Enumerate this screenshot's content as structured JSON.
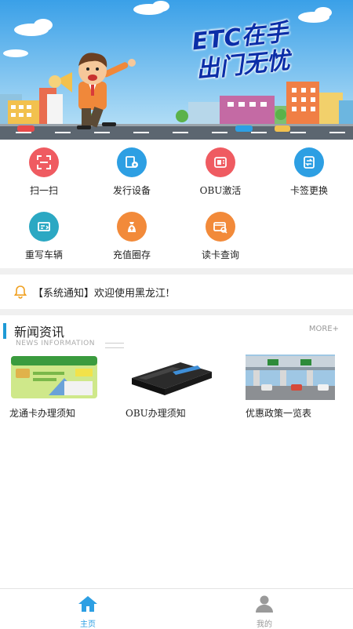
{
  "banner": {
    "title_line1": "ETC在手",
    "title_line2": "出门无忧"
  },
  "grid": {
    "items": [
      {
        "label": "扫一扫",
        "color": "#ef5b61",
        "icon": "scan-icon"
      },
      {
        "label": "发行设备",
        "color": "#2d9fe3",
        "icon": "issue-device-icon"
      },
      {
        "label": "OBU激活",
        "color": "#ef5b61",
        "icon": "obu-activate-icon"
      },
      {
        "label": "卡签更换",
        "color": "#2d9fe3",
        "icon": "card-tag-replace-icon"
      },
      {
        "label": "重写车辆",
        "color": "#2ba8c3",
        "icon": "rewrite-vehicle-icon"
      },
      {
        "label": "充值圈存",
        "color": "#f28a3a",
        "icon": "recharge-icon"
      },
      {
        "label": "读卡查询",
        "color": "#f28a3a",
        "icon": "read-card-icon"
      }
    ]
  },
  "notice": {
    "text": "【系统通知】欢迎使用黑龙江!",
    "bell_color": "#f0a020"
  },
  "news": {
    "title": "新闻资讯",
    "subtitle": "NEWS INFORMATION",
    "more": "MORE+",
    "accent": "#1e9ad6",
    "items": [
      {
        "caption": "龙通卡办理须知",
        "image": "card-image"
      },
      {
        "caption": "OBU办理须知",
        "image": "obu-device-image"
      },
      {
        "caption": "优惠政策一览表",
        "image": "toll-station-image"
      }
    ]
  },
  "tabbar": {
    "tabs": [
      {
        "label": "主页",
        "active": true,
        "color": "#2d9fe3"
      },
      {
        "label": "我的",
        "active": false,
        "color": "#999999"
      }
    ]
  }
}
